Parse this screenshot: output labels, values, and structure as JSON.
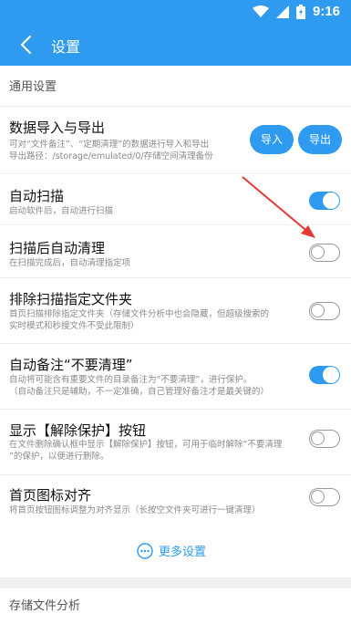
{
  "status_bar": {
    "time": "9:16"
  },
  "app_bar": {
    "title": "设置"
  },
  "general": {
    "header": "通用设置",
    "import_export": {
      "title": "数据导入与导出",
      "desc_line1": "可对“文件备注”、“定期清理”的数据进行导入和导出",
      "desc_line2": "导出路径：/storage/emulated/0/存储空间清理备份",
      "import_label": "导入",
      "export_label": "导出"
    },
    "auto_scan": {
      "title": "自动扫描",
      "desc": "启动软件后，自动进行扫描",
      "enabled": true
    },
    "auto_clean": {
      "title": "扫描后自动清理",
      "desc": "在扫描完成后，自动清理指定项",
      "enabled": false
    },
    "exclude_folder": {
      "title": "排除扫描指定文件夹",
      "desc_line1": "首页扫描排除指定文件夹（存储文件分析中也会隐藏，但超级搜索的",
      "desc_line2": "实时模式和秒搜文件不受此限制）",
      "enabled": false
    },
    "auto_note": {
      "title": "自动备注“不要清理”",
      "desc_line1": "自动将可能含有重要文件的目录备注为“不要清理”，进行保护。",
      "desc_line2": "（自动备注只是辅助，不一定准确，自己管理好备注才是最关键的）",
      "enabled": true
    },
    "show_unprotect": {
      "title": "显示【解除保护】按钮",
      "desc_line1": "在文件删除确认框中显示【解除保护】按钮，可用于临时解除“不要清理",
      "desc_line2": "”的保护，以便进行删除。",
      "enabled": false
    },
    "align_icons": {
      "title": "首页图标对齐",
      "desc": "将首页按钮图标调整为对齐显示（长按空文件夹可进行一键清理）",
      "enabled": false
    },
    "more_label": "更多设置"
  },
  "storage": {
    "header": "存储文件分析"
  },
  "colors": {
    "primary": "#2e9bf0"
  }
}
